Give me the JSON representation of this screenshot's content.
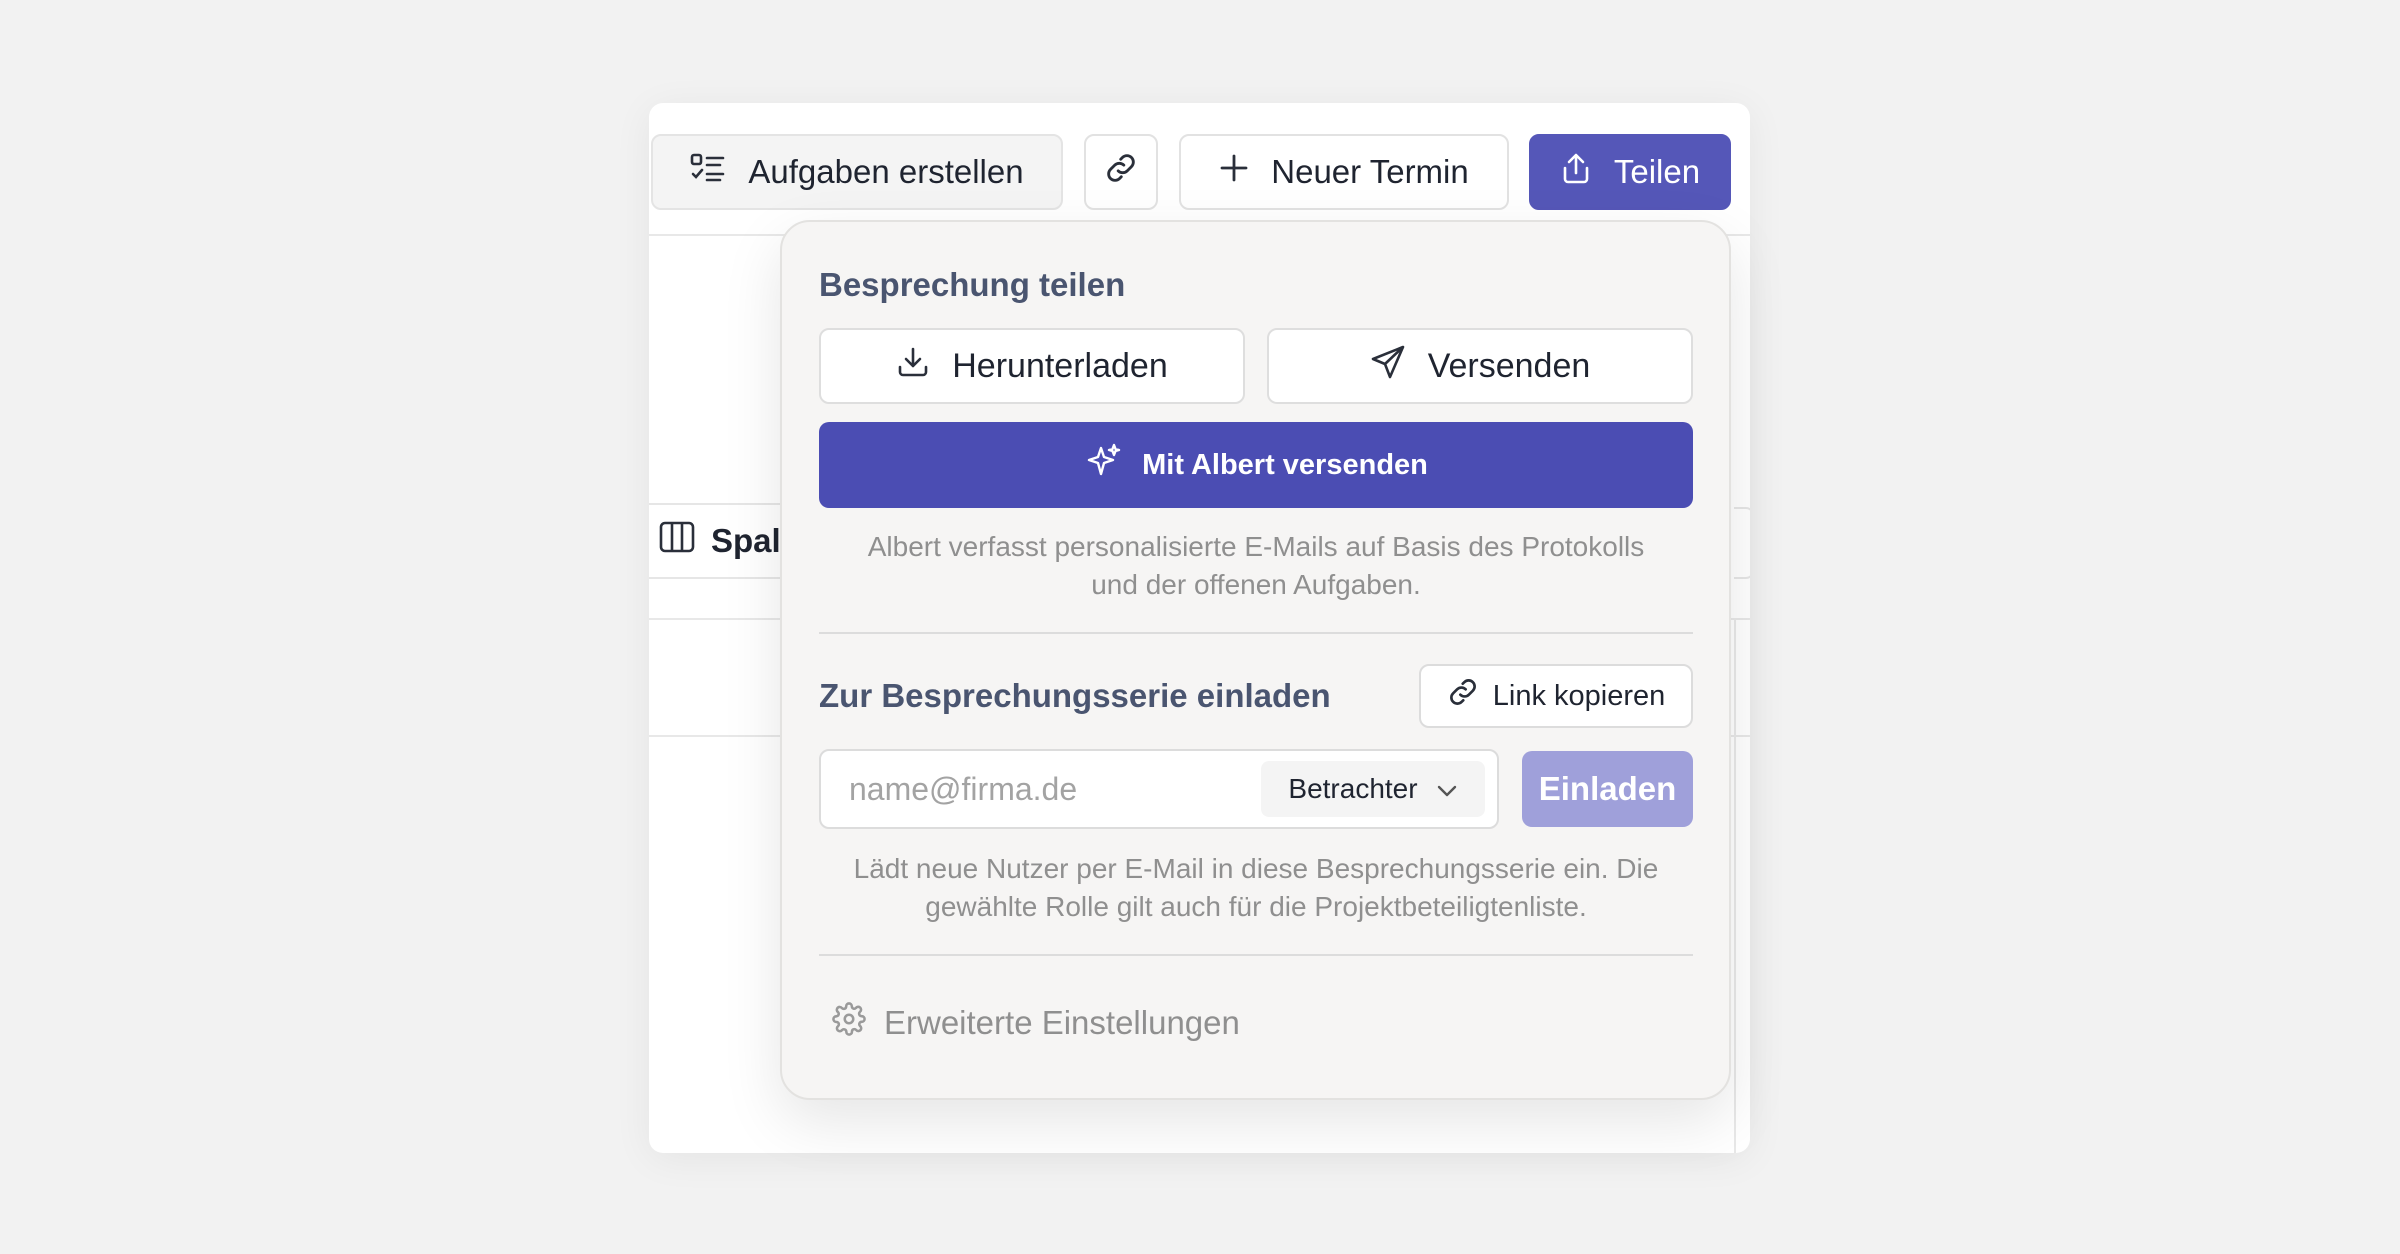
{
  "toolbar": {
    "tasks_label": "Aufgaben erstellen",
    "new_event_label": "Neuer Termin",
    "share_label": "Teilen"
  },
  "background": {
    "columns_label": "Spal"
  },
  "share_popover": {
    "title": "Besprechung teilen",
    "download_label": "Herunterladen",
    "send_label": "Versenden",
    "albert_label": "Mit Albert versenden",
    "albert_hint_line1": "Albert verfasst personalisierte E-Mails auf Basis des Protokolls",
    "albert_hint_line2": "und der offenen Aufgaben.",
    "invite_title": "Zur Besprechungsserie einladen",
    "copy_link_label": "Link kopieren",
    "email_placeholder": "name@firma.de",
    "email_value": "",
    "role_selected": "Betrachter",
    "invite_label": "Einladen",
    "invite_hint_line1": "Lädt neue Nutzer per E-Mail in diese Besprechungsserie ein. Die",
    "invite_hint_line2": "gewählte Rolle gilt auch für die Projektbeteiligtenliste.",
    "advanced_label": "Erweiterte Einstellungen"
  },
  "colors": {
    "primary": "#5557b8",
    "albert_button": "#4b4db3",
    "invite_disabled": "#9fa0da",
    "section_title": "#4a5570",
    "hint_text": "#8f8f8f",
    "page_background": "#f2f2f2",
    "popover_background": "#f6f5f4"
  }
}
